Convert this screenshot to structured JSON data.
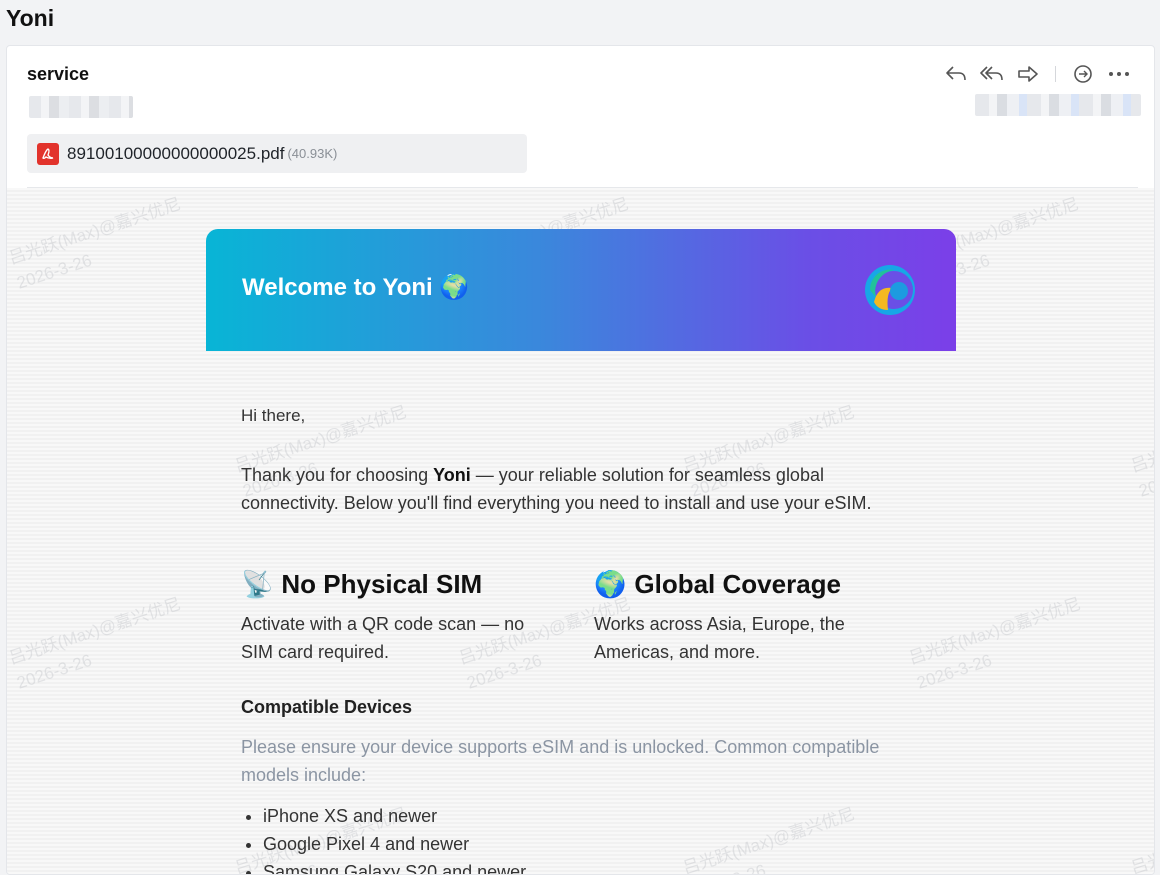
{
  "page": {
    "title": "Yoni"
  },
  "mail": {
    "sender": "service",
    "attachment": {
      "name": "89100100000000000025.pdf",
      "size": "(40.93K)"
    },
    "toolbar": [
      "reply-icon",
      "reply-all-icon",
      "forward-icon",
      "comment-icon",
      "more-icon"
    ]
  },
  "watermark": {
    "name": "吕光跃(Max)@嘉兴优尼",
    "date": "2026-3-26"
  },
  "email": {
    "hero_title": "Welcome to Yoni",
    "hero_emoji": "🌍",
    "greeting": "Hi there,",
    "intro_pre": "Thank you for choosing ",
    "intro_brand": "Yoni",
    "intro_post": " — your reliable solution for seamless global connectivity. Below you'll find everything you need to install and use your eSIM.",
    "features": [
      {
        "emoji": "📡",
        "title": "No Physical SIM",
        "desc": "Activate with a QR code scan — no SIM card required."
      },
      {
        "emoji": "🌍",
        "title": "Global Coverage",
        "desc": "Works across Asia, Europe, the Americas, and more."
      }
    ],
    "devices_title": "Compatible Devices",
    "devices_note": "Please ensure your device supports eSIM and is unlocked. Common compatible models include:",
    "devices": [
      "iPhone XS and newer",
      "Google Pixel 4 and newer",
      "Samsung Galaxy S20 and newer"
    ]
  },
  "colors": {
    "hero_start": "#08b5d6",
    "hero_end": "#7b3fe8",
    "pdf": "#e2332c"
  }
}
